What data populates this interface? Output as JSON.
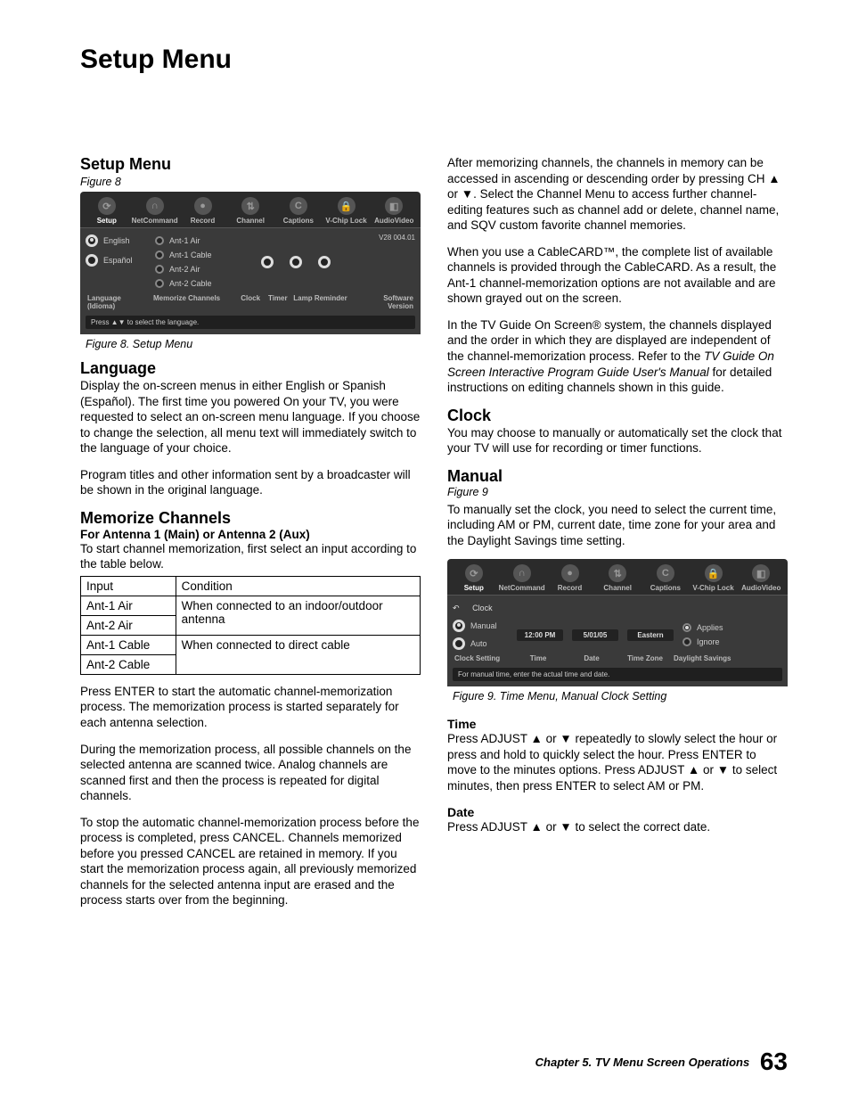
{
  "page_title": "Setup Menu",
  "left": {
    "setup_menu_heading": "Setup Menu",
    "figure8_label": "Figure 8",
    "figure8_caption": "Figure 8. Setup Menu",
    "language_heading": "Language",
    "language_p1": "Display the on-screen menus in either English or Spanish (Español).  The first time you powered On your TV, you were requested to select an on-screen menu language.  If you choose to change the selection, all menu text will immediately switch to the language of your choice.",
    "language_p2": "Program titles and other information sent by a broadcaster will be shown in the original language.",
    "memorize_heading": "Memorize Channels",
    "memorize_sub": "For Antenna 1 (Main) or Antenna 2 (Aux)",
    "memorize_intro": "To start channel memorization, first select an input according to the table below.",
    "input_table": {
      "h_input": "Input",
      "h_condition": "Condition",
      "rows": [
        {
          "input": "Ant-1 Air",
          "cond": "When connected to an indoor/outdoor antenna",
          "rowspan": 2
        },
        {
          "input": "Ant-2 Air"
        },
        {
          "input": "Ant-1 Cable",
          "cond": "When connected to direct cable",
          "rowspan": 2
        },
        {
          "input": "Ant-2 Cable"
        }
      ]
    },
    "memorize_p1": "Press ENTER to start the automatic channel-memorization process.  The memorization process is started separately for each antenna selection.",
    "memorize_p2": "During the memorization process, all possible channels on the selected antenna are scanned twice.  Analog channels are scanned first and then the process is repeated for digital channels.",
    "memorize_p3": "To stop the automatic channel-memorization process before the process is completed, press CANCEL.  Channels memorized before you pressed CANCEL are retained in memory.  If you start the memorization process again, all previously memorized channels for the selected antenna input are erased and the process starts over from the beginning."
  },
  "right": {
    "p1a": "After memorizing channels, the channels in memory can be accessed in ascending or descending order by pressing CH ",
    "p1b": " or ",
    "p1c": ".  Select the Channel Menu to access further channel-editing features such as channel add or delete, channel name, and SQV custom favorite channel memories.",
    "p2": "When you use a CableCARD™, the complete list of available channels is provided through the CableCARD.  As a result, the Ant-1 channel-memorization options are not available and are shown grayed out on the screen.",
    "p3a": "In the TV Guide On Screen® system, the channels displayed and the order in which they are displayed are independent of the channel-memorization process.  Refer to the ",
    "p3i": "TV Guide On Screen Interactive Program Guide User's Manual",
    "p3b": " for detailed instructions on editing channels shown in this guide.",
    "clock_heading": "Clock",
    "clock_p": "You may choose to manually or automatically set the clock that your TV will use for recording or timer functions.",
    "manual_heading": "Manual",
    "figure9_label": "Figure 9",
    "manual_p": "To manually set the clock, you need to select  the  current time, including AM or PM,  current date, time zone for your area and the Daylight Savings time setting.",
    "figure9_caption": "Figure 9. Time Menu, Manual Clock Setting",
    "time_heading": "Time",
    "time_p_a": "Press ADJUST ",
    "time_p_b": " or ",
    "time_p_c": "  repeatedly to slowly select the hour or press and hold to quickly select the hour.  Press ENTER to move to the minutes options.  Press ADJUST ",
    "time_p_d": " or ",
    "time_p_e": " to select minutes, then press ENTER to select AM or PM.",
    "date_heading": "Date",
    "date_p_a": "Press ADJUST ",
    "date_p_b": " or ",
    "date_p_c": " to select the correct date."
  },
  "tv_tabs": [
    "Setup",
    "NetCommand",
    "Record",
    "Channel",
    "Captions",
    "V-Chip Lock",
    "AudioVideo"
  ],
  "fig8": {
    "lang_english": "English",
    "lang_espanol": "Español",
    "lang_label": "Language (Idioma)",
    "mem_items": [
      "Ant-1 Air",
      "Ant-1 Cable",
      "Ant-2 Air",
      "Ant-2 Cable"
    ],
    "mem_label": "Memorize Channels",
    "clock_label": "Clock",
    "timer_label": "Timer",
    "lamp_label": "Lamp Reminder",
    "sw_ver": "V28 004.01",
    "sw_label": "Software Version",
    "hint": "Press ▲▼ to select the language."
  },
  "fig9": {
    "clock": "Clock",
    "manual": "Manual",
    "auto": "Auto",
    "setting": "Clock Setting",
    "time_val": "12:00 PM",
    "date_val": "5/01/05",
    "tz_val": "Eastern",
    "applies": "Applies",
    "ignore": "Ignore",
    "time_l": "Time",
    "date_l": "Date",
    "tz_l": "Time Zone",
    "ds_l": "Daylight Savings",
    "hint": "For manual time, enter the actual time and date."
  },
  "footer": {
    "chapter": "Chapter 5. TV Menu Screen Operations",
    "page": "63"
  },
  "glyphs": {
    "up": "▲",
    "down": "▼"
  }
}
